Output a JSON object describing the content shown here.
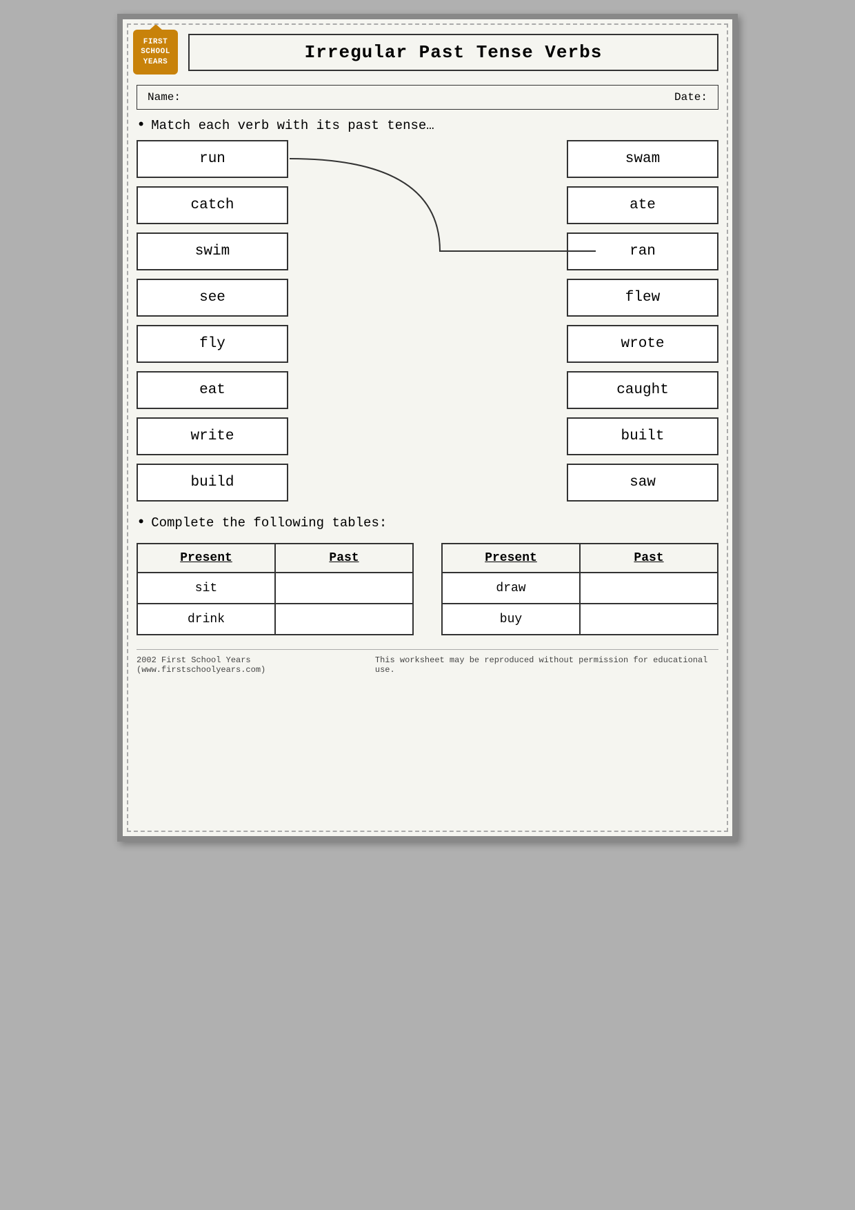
{
  "header": {
    "logo_line1": "FIRST",
    "logo_line2": "SCHOOL",
    "logo_line3": "YEARS",
    "title": "Irregular Past Tense Verbs"
  },
  "name_date": {
    "name_label": "Name:",
    "date_label": "Date:"
  },
  "instruction1": "Match each verb with its past tense…",
  "present_verbs": [
    "run",
    "catch",
    "swim",
    "see",
    "fly",
    "eat",
    "write",
    "build"
  ],
  "past_verbs": [
    "swam",
    "ate",
    "ran",
    "flew",
    "wrote",
    "caught",
    "built",
    "saw"
  ],
  "instruction2": "Complete the following tables:",
  "table1": {
    "col1_header": "Present",
    "col2_header": "Past",
    "rows": [
      {
        "present": "sit",
        "past": ""
      },
      {
        "present": "drink",
        "past": ""
      }
    ]
  },
  "table2": {
    "col1_header": "Present",
    "col2_header": "Past",
    "rows": [
      {
        "present": "draw",
        "past": ""
      },
      {
        "present": "buy",
        "past": ""
      }
    ]
  },
  "footer": {
    "left": "2002 First School Years  (www.firstschoolyears.com)",
    "right": "This worksheet may be reproduced without permission for educational use."
  }
}
